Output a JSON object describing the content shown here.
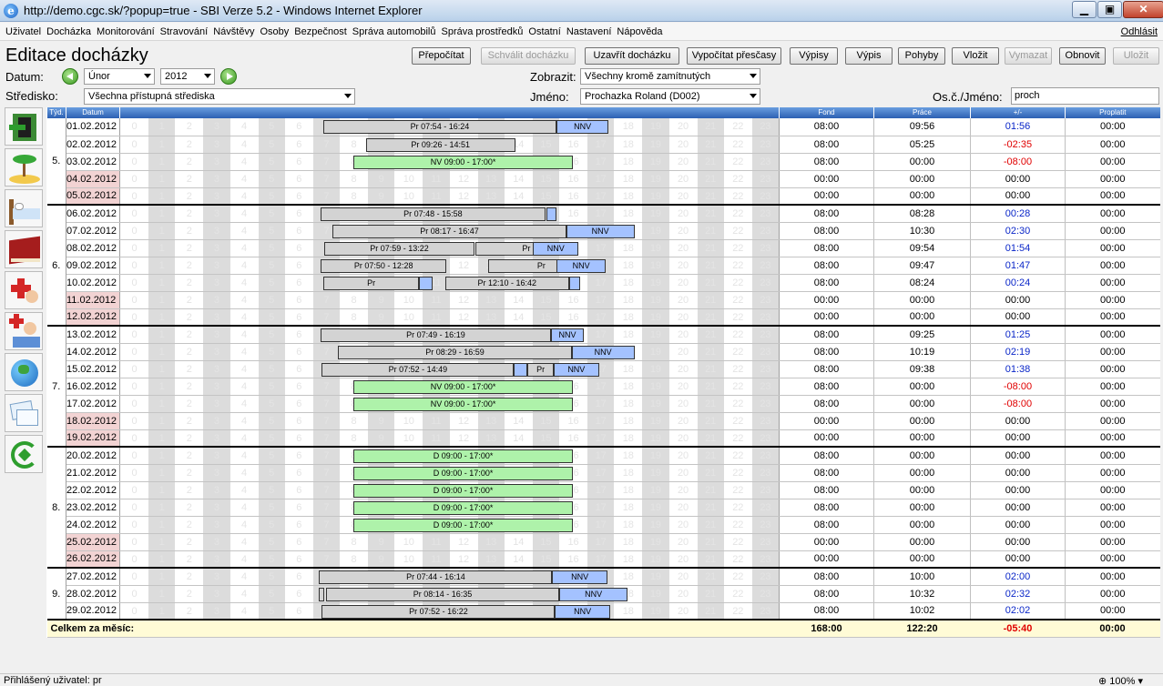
{
  "window": {
    "title": "http://demo.cgc.sk/?popup=true - SBI Verze 5.2 - Windows Internet Explorer"
  },
  "menu": {
    "items": [
      "Uživatel",
      "Docházka",
      "Monitorování",
      "Stravování",
      "Návštěvy",
      "Osoby",
      "Bezpečnost",
      "Správa automobilů",
      "Správa prostředků",
      "Ostatní",
      "Nastavení",
      "Nápověda"
    ],
    "logout": "Odhlásit"
  },
  "page": {
    "title": "Editace docházky"
  },
  "toolbar": {
    "recalc": "Přepočítat",
    "approve": "Schválit docházku",
    "close": "Uzavřít docházku",
    "overtime": "Vypočítat přesčasy",
    "listings": "Výpisy",
    "listing": "Výpis",
    "moves": "Pohyby",
    "insert": "Vložit",
    "delete": "Vymazat",
    "refresh": "Obnovit",
    "save": "Uložit"
  },
  "filters": {
    "date_label": "Datum:",
    "month": "Únor",
    "year": "2012",
    "show_label": "Zobrazit:",
    "show_value": "Všechny kromě zamítnutých",
    "center_label": "Středisko:",
    "center_value": "Všechna přístupná střediska",
    "name_label": "Jméno:",
    "name_value": "Prochazka Roland (D002)",
    "id_label": "Os.č./Jméno:",
    "id_value": "proch"
  },
  "sidebar": [
    "door-exit-icon",
    "island-vacation-icon",
    "bed-sick-icon",
    "books-study-icon",
    "doctor-cross-icon",
    "doctor-family-icon",
    "globe-business-trip-icon",
    "cards-icon",
    "recycle-arrows-icon"
  ],
  "table": {
    "headers": {
      "week": "Týd.",
      "date": "Datum",
      "fond": "Fond",
      "work": "Práce",
      "diff": "+/-",
      "paid": "Proplatit"
    },
    "hours": [
      "0",
      "1",
      "2",
      "3",
      "4",
      "5",
      "6",
      "7",
      "8",
      "9",
      "10",
      "11",
      "12",
      "13",
      "14",
      "15",
      "16",
      "17",
      "18",
      "19",
      "20",
      "21",
      "22",
      "23"
    ],
    "weeks": [
      {
        "n": "5.",
        "rows": [
          {
            "date": "01.02.2012",
            "we": false,
            "fond": "08:00",
            "work": "09:56",
            "diff": "01:56",
            "paid": "00:00",
            "bars": [
              [
                "g",
                7.4,
                8.5,
                "Pr 07:54 - 16:24"
              ],
              [
                "b",
                15.9,
                1.9,
                "NNV"
              ]
            ]
          },
          {
            "date": "02.02.2012",
            "we": false,
            "fond": "08:00",
            "work": "05:25",
            "diff": "-02:35",
            "paid": "00:00",
            "bars": [
              [
                "g",
                8.95,
                5.45,
                "Pr 09:26 - 14:51"
              ]
            ]
          },
          {
            "date": "03.02.2012",
            "we": false,
            "fond": "08:00",
            "work": "00:00",
            "diff": "-08:00",
            "paid": "00:00",
            "bars": [
              [
                "gr",
                8.5,
                8.0,
                "NV 09:00 - 17:00*"
              ]
            ]
          },
          {
            "date": "04.02.2012",
            "we": true,
            "fond": "00:00",
            "work": "00:00",
            "diff": "00:00",
            "paid": "00:00",
            "bars": []
          },
          {
            "date": "05.02.2012",
            "we": true,
            "fond": "00:00",
            "work": "00:00",
            "diff": "00:00",
            "paid": "00:00",
            "bars": []
          }
        ]
      },
      {
        "n": "6.",
        "rows": [
          {
            "date": "06.02.2012",
            "we": false,
            "fond": "08:00",
            "work": "08:28",
            "diff": "00:28",
            "paid": "00:00",
            "bars": [
              [
                "g",
                7.3,
                8.2,
                "Pr 07:48 - 15:58"
              ],
              [
                "b",
                15.55,
                0.35,
                ""
              ]
            ]
          },
          {
            "date": "07.02.2012",
            "we": false,
            "fond": "08:00",
            "work": "10:30",
            "diff": "02:30",
            "paid": "00:00",
            "bars": [
              [
                "g",
                7.75,
                8.5,
                "Pr 08:17 - 16:47"
              ],
              [
                "b",
                16.25,
                2.5,
                "NNV"
              ]
            ]
          },
          {
            "date": "08.02.2012",
            "we": false,
            "fond": "08:00",
            "work": "09:54",
            "diff": "01:54",
            "paid": "00:00",
            "bars": [
              [
                "g",
                7.45,
                5.45,
                "Pr 07:59 - 13:22"
              ],
              [
                "g",
                12.95,
                3.7,
                "Pr"
              ],
              [
                "b",
                15.05,
                1.65,
                "NNV"
              ]
            ]
          },
          {
            "date": "09.02.2012",
            "we": false,
            "fond": "08:00",
            "work": "09:47",
            "diff": "01:47",
            "paid": "00:00",
            "bars": [
              [
                "g",
                7.3,
                4.6,
                "Pr 07:50 - 12:28"
              ],
              [
                "g",
                13.4,
                3.9,
                "Pr"
              ],
              [
                "b",
                15.9,
                1.8,
                "NNV"
              ]
            ]
          },
          {
            "date": "10.02.2012",
            "we": false,
            "fond": "08:00",
            "work": "08:24",
            "diff": "00:24",
            "paid": "00:00",
            "bars": [
              [
                "g",
                7.4,
                3.5,
                "Pr"
              ],
              [
                "b",
                10.9,
                0.5,
                ""
              ],
              [
                "g",
                11.85,
                4.5,
                "Pr 12:10 - 16:42"
              ],
              [
                "b",
                16.35,
                0.4,
                ""
              ]
            ]
          },
          {
            "date": "11.02.2012",
            "we": true,
            "fond": "00:00",
            "work": "00:00",
            "diff": "00:00",
            "paid": "00:00",
            "bars": []
          },
          {
            "date": "12.02.2012",
            "we": true,
            "fond": "00:00",
            "work": "00:00",
            "diff": "00:00",
            "paid": "00:00",
            "bars": []
          }
        ]
      },
      {
        "n": "7.",
        "rows": [
          {
            "date": "13.02.2012",
            "we": false,
            "fond": "08:00",
            "work": "09:25",
            "diff": "01:25",
            "paid": "00:00",
            "bars": [
              [
                "g",
                7.3,
                8.4,
                "Pr 07:49 - 16:19"
              ],
              [
                "b",
                15.7,
                1.2,
                "NNV"
              ]
            ]
          },
          {
            "date": "14.02.2012",
            "we": false,
            "fond": "08:00",
            "work": "10:19",
            "diff": "02:19",
            "paid": "00:00",
            "bars": [
              [
                "g",
                7.95,
                8.5,
                "Pr 08:29 - 16:59"
              ],
              [
                "b",
                16.45,
                2.3,
                "NNV"
              ]
            ]
          },
          {
            "date": "15.02.2012",
            "we": false,
            "fond": "08:00",
            "work": "09:38",
            "diff": "01:38",
            "paid": "00:00",
            "bars": [
              [
                "g",
                7.35,
                7.0,
                "Pr 07:52 - 14:49"
              ],
              [
                "b",
                14.35,
                0.5,
                ""
              ],
              [
                "g",
                14.85,
                0.95,
                "Pr"
              ],
              [
                "b",
                15.8,
                1.65,
                "NNV"
              ]
            ]
          },
          {
            "date": "16.02.2012",
            "we": false,
            "fond": "08:00",
            "work": "00:00",
            "diff": "-08:00",
            "paid": "00:00",
            "bars": [
              [
                "gr",
                8.5,
                8.0,
                "NV 09:00 - 17:00*"
              ]
            ]
          },
          {
            "date": "17.02.2012",
            "we": false,
            "fond": "08:00",
            "work": "00:00",
            "diff": "-08:00",
            "paid": "00:00",
            "bars": [
              [
                "gr",
                8.5,
                8.0,
                "NV 09:00 - 17:00*"
              ]
            ]
          },
          {
            "date": "18.02.2012",
            "we": true,
            "fond": "00:00",
            "work": "00:00",
            "diff": "00:00",
            "paid": "00:00",
            "bars": []
          },
          {
            "date": "19.02.2012",
            "we": true,
            "fond": "00:00",
            "work": "00:00",
            "diff": "00:00",
            "paid": "00:00",
            "bars": []
          }
        ]
      },
      {
        "n": "8.",
        "rows": [
          {
            "date": "20.02.2012",
            "we": false,
            "fond": "08:00",
            "work": "00:00",
            "diff": "00:00",
            "paid": "00:00",
            "bars": [
              [
                "gr",
                8.5,
                8.0,
                "D 09:00 - 17:00*"
              ]
            ]
          },
          {
            "date": "21.02.2012",
            "we": false,
            "fond": "08:00",
            "work": "00:00",
            "diff": "00:00",
            "paid": "00:00",
            "bars": [
              [
                "gr",
                8.5,
                8.0,
                "D 09:00 - 17:00*"
              ]
            ]
          },
          {
            "date": "22.02.2012",
            "we": false,
            "fond": "08:00",
            "work": "00:00",
            "diff": "00:00",
            "paid": "00:00",
            "bars": [
              [
                "gr",
                8.5,
                8.0,
                "D 09:00 - 17:00*"
              ]
            ]
          },
          {
            "date": "23.02.2012",
            "we": false,
            "fond": "08:00",
            "work": "00:00",
            "diff": "00:00",
            "paid": "00:00",
            "bars": [
              [
                "gr",
                8.5,
                8.0,
                "D 09:00 - 17:00*"
              ]
            ]
          },
          {
            "date": "24.02.2012",
            "we": false,
            "fond": "08:00",
            "work": "00:00",
            "diff": "00:00",
            "paid": "00:00",
            "bars": [
              [
                "gr",
                8.5,
                8.0,
                "D 09:00 - 17:00*"
              ]
            ]
          },
          {
            "date": "25.02.2012",
            "we": true,
            "fond": "00:00",
            "work": "00:00",
            "diff": "00:00",
            "paid": "00:00",
            "bars": []
          },
          {
            "date": "26.02.2012",
            "we": true,
            "fond": "00:00",
            "work": "00:00",
            "diff": "00:00",
            "paid": "00:00",
            "bars": []
          }
        ]
      },
      {
        "n": "9.",
        "rows": [
          {
            "date": "27.02.2012",
            "we": false,
            "fond": "08:00",
            "work": "10:00",
            "diff": "02:00",
            "paid": "00:00",
            "bars": [
              [
                "g",
                7.25,
                8.5,
                "Pr 07:44 - 16:14"
              ],
              [
                "b",
                15.75,
                2.0,
                "NNV"
              ]
            ]
          },
          {
            "date": "28.02.2012",
            "we": false,
            "fond": "08:00",
            "work": "10:32",
            "diff": "02:32",
            "paid": "00:00",
            "bars": [
              [
                "g",
                7.25,
                0.2,
                ""
              ],
              [
                "g",
                7.5,
                8.5,
                "Pr 08:14 - 16:35"
              ],
              [
                "b",
                16.0,
                2.5,
                "NNV"
              ]
            ]
          },
          {
            "date": "29.02.2012",
            "we": false,
            "fond": "08:00",
            "work": "10:02",
            "diff": "02:02",
            "paid": "00:00",
            "bars": [
              [
                "g",
                7.35,
                8.5,
                "Pr 07:52 - 16:22"
              ],
              [
                "b",
                15.85,
                2.0,
                "NNV"
              ]
            ]
          }
        ]
      }
    ],
    "total": {
      "label": "Celkem za měsíc:",
      "fond": "168:00",
      "work": "122:20",
      "diff": "-05:40",
      "paid": "00:00"
    }
  },
  "status": {
    "user": "Přihlášený uživatel:  pr",
    "zoom": "100%"
  },
  "colors": {
    "header_blue": "#2c60b2",
    "weekend_pink": "#f2d3d3",
    "bar_gray": "#d3d3d3",
    "bar_blue": "#a4c2ff",
    "bar_green": "#aef2aa",
    "positive": "#0a26c8",
    "negative": "#e00000"
  }
}
